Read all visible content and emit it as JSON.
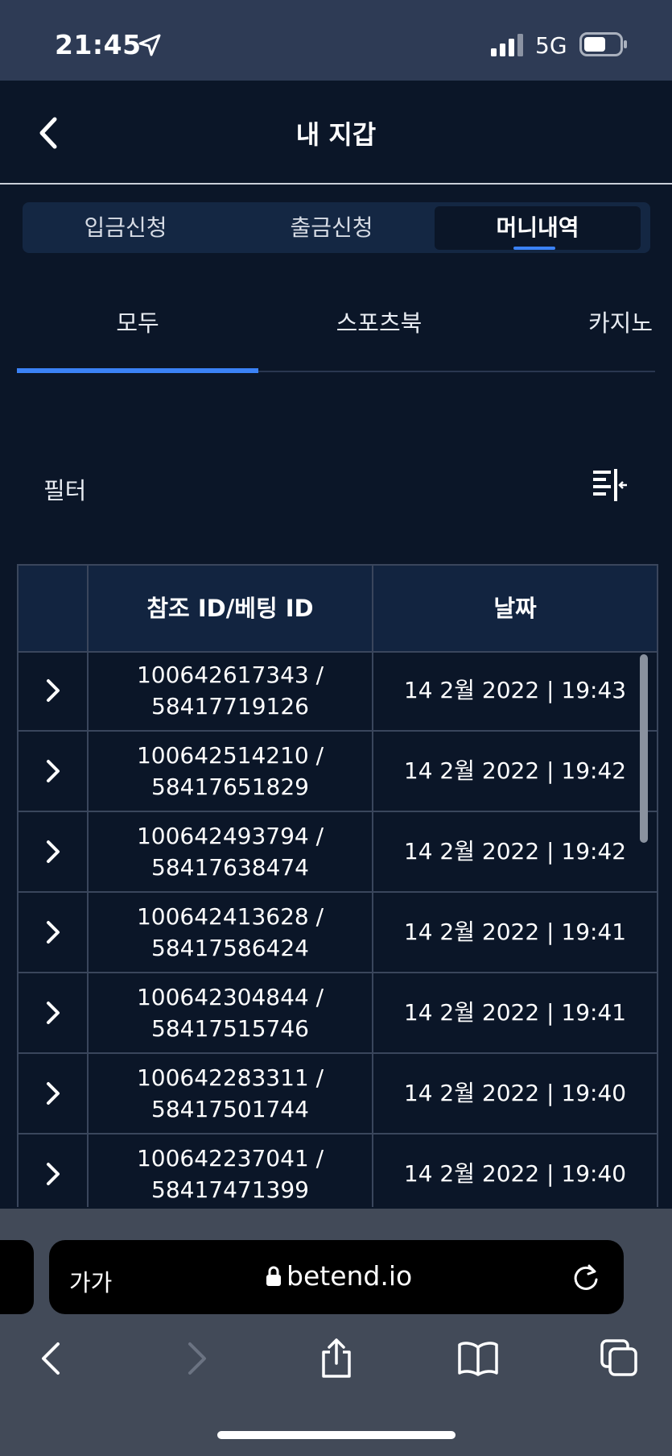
{
  "status_bar": {
    "time": "21:45",
    "network": "5G"
  },
  "header": {
    "title": "내 지갑"
  },
  "segment_tabs": [
    {
      "label": "입금신청",
      "active": false
    },
    {
      "label": "출금신청",
      "active": false
    },
    {
      "label": "머니내역",
      "active": true
    }
  ],
  "sub_tabs": [
    {
      "label": "모두",
      "active": true
    },
    {
      "label": "스포츠북",
      "active": false
    },
    {
      "label": "카지노",
      "active": false
    }
  ],
  "filter": {
    "label": "필터"
  },
  "table": {
    "headers": {
      "ref_id": "참조 ID/베팅 ID",
      "date": "날짜"
    },
    "rows": [
      {
        "ref_id": "100642617343 /",
        "bet_id": "58417719126",
        "date": "14 2월 2022 | 19:43"
      },
      {
        "ref_id": "100642514210 /",
        "bet_id": "58417651829",
        "date": "14 2월 2022 | 19:42"
      },
      {
        "ref_id": "100642493794 /",
        "bet_id": "58417638474",
        "date": "14 2월 2022 | 19:42"
      },
      {
        "ref_id": "100642413628 /",
        "bet_id": "58417586424",
        "date": "14 2월 2022 | 19:41"
      },
      {
        "ref_id": "100642304844 /",
        "bet_id": "58417515746",
        "date": "14 2월 2022 | 19:41"
      },
      {
        "ref_id": "100642283311 /",
        "bet_id": "58417501744",
        "date": "14 2월 2022 | 19:40"
      },
      {
        "ref_id": "100642237041 /",
        "bet_id": "58417471399",
        "date": "14 2월 2022 | 19:40"
      }
    ]
  },
  "browser": {
    "text_size_label": "가가",
    "url": "betend.io"
  },
  "colors": {
    "background": "#0b1628",
    "accent": "#3b82f6",
    "status_bar": "#2e3b55",
    "toolbar": "#424a58"
  }
}
